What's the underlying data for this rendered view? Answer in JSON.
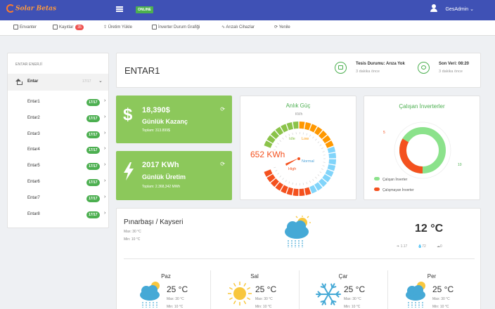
{
  "topbar": {
    "logo_text": "Solar Betas",
    "online_badge": "ONLINE",
    "user_name": "GesAdmin",
    "brand_color": "#3f51b5"
  },
  "toolbar": {
    "items": [
      {
        "label": "Envanter",
        "icon": "inventory-icon"
      },
      {
        "label": "Kayıtlar",
        "icon": "records-icon",
        "badge": "35"
      },
      {
        "label": "Üretim Yükle",
        "icon": "upload-icon"
      },
      {
        "label": "İnverter Durum Grafiği",
        "icon": "monitor-icon"
      },
      {
        "label": "Arızalı Cihazlar",
        "icon": "pulse-icon"
      },
      {
        "label": "Yenile",
        "icon": "refresh-icon"
      }
    ]
  },
  "sidebar": {
    "title": "ENTAR ENERJİ",
    "group_label": "Entar",
    "group_badge": "17/17",
    "items": [
      {
        "label": "Entar1",
        "badge": "17/17"
      },
      {
        "label": "Entar2",
        "badge": "17/17"
      },
      {
        "label": "Entar3",
        "badge": "17/17"
      },
      {
        "label": "Entar4",
        "badge": "17/17"
      },
      {
        "label": "Entar5",
        "badge": "17/17"
      },
      {
        "label": "Entar6",
        "badge": "17/17"
      },
      {
        "label": "Entar7",
        "badge": "17/17"
      },
      {
        "label": "Entar8",
        "badge": "17/17"
      }
    ]
  },
  "header": {
    "title": "ENTAR1",
    "status_label": "Tesis Durumu: Arıza Yok",
    "status_time": "3 dakika önce",
    "last_data_label": "Son Veri: 08:20",
    "last_data_time": "3 dakika önce"
  },
  "earnings": {
    "value": "18,390$",
    "label": "Günlük Kazanç",
    "total": "Toplam: 313.899$",
    "icon": "dollar-icon"
  },
  "production": {
    "value": "2017 KWh",
    "label": "Günlük Üretim",
    "total": "Toplam: 2.368,342 MWh",
    "icon": "bolt-icon"
  },
  "gauge": {
    "title": "Anlık Güç",
    "unit": "KWh",
    "value": "652 KWh",
    "labels": {
      "idle": "Idle",
      "low": "Low",
      "normal": "Normal",
      "high": "High"
    },
    "colors": {
      "idle": "#8bc34a",
      "low": "#ff9800",
      "normal": "#81d4fa",
      "high": "#f4511e"
    }
  },
  "inverters": {
    "title": "Çalışan İnverterler",
    "working": 10,
    "failing": 5,
    "legend_working": "Çalışan İnverter",
    "legend_failing": "Çalışmayan İnverter",
    "color_working": "#8be28b",
    "color_failing": "#f4511e"
  },
  "weather": {
    "city": "Pınarbaşı / Kayseri",
    "max": "Max: 30 °C",
    "min": "Min: 10 °C",
    "temp": "12 °C",
    "wind": "1.17",
    "humidity": "72",
    "clouds": "0",
    "days": [
      {
        "name": "Paz",
        "temp": "25 °C",
        "max": "Max: 30 °C",
        "min": "Min: 10 °C",
        "icon": "rain-cloud-icon"
      },
      {
        "name": "Sal",
        "temp": "25 °C",
        "max": "Max: 30 °C",
        "min": "Min: 10 °C",
        "icon": "sun-icon"
      },
      {
        "name": "Çar",
        "temp": "25 °C",
        "max": "Max: 30 °C",
        "min": "Min: 10 °C",
        "icon": "snowflake-icon"
      },
      {
        "name": "Per",
        "temp": "25 °C",
        "max": "Max: 30 °C",
        "min": "Min: 10 °C",
        "icon": "rain-cloud-icon"
      }
    ]
  }
}
